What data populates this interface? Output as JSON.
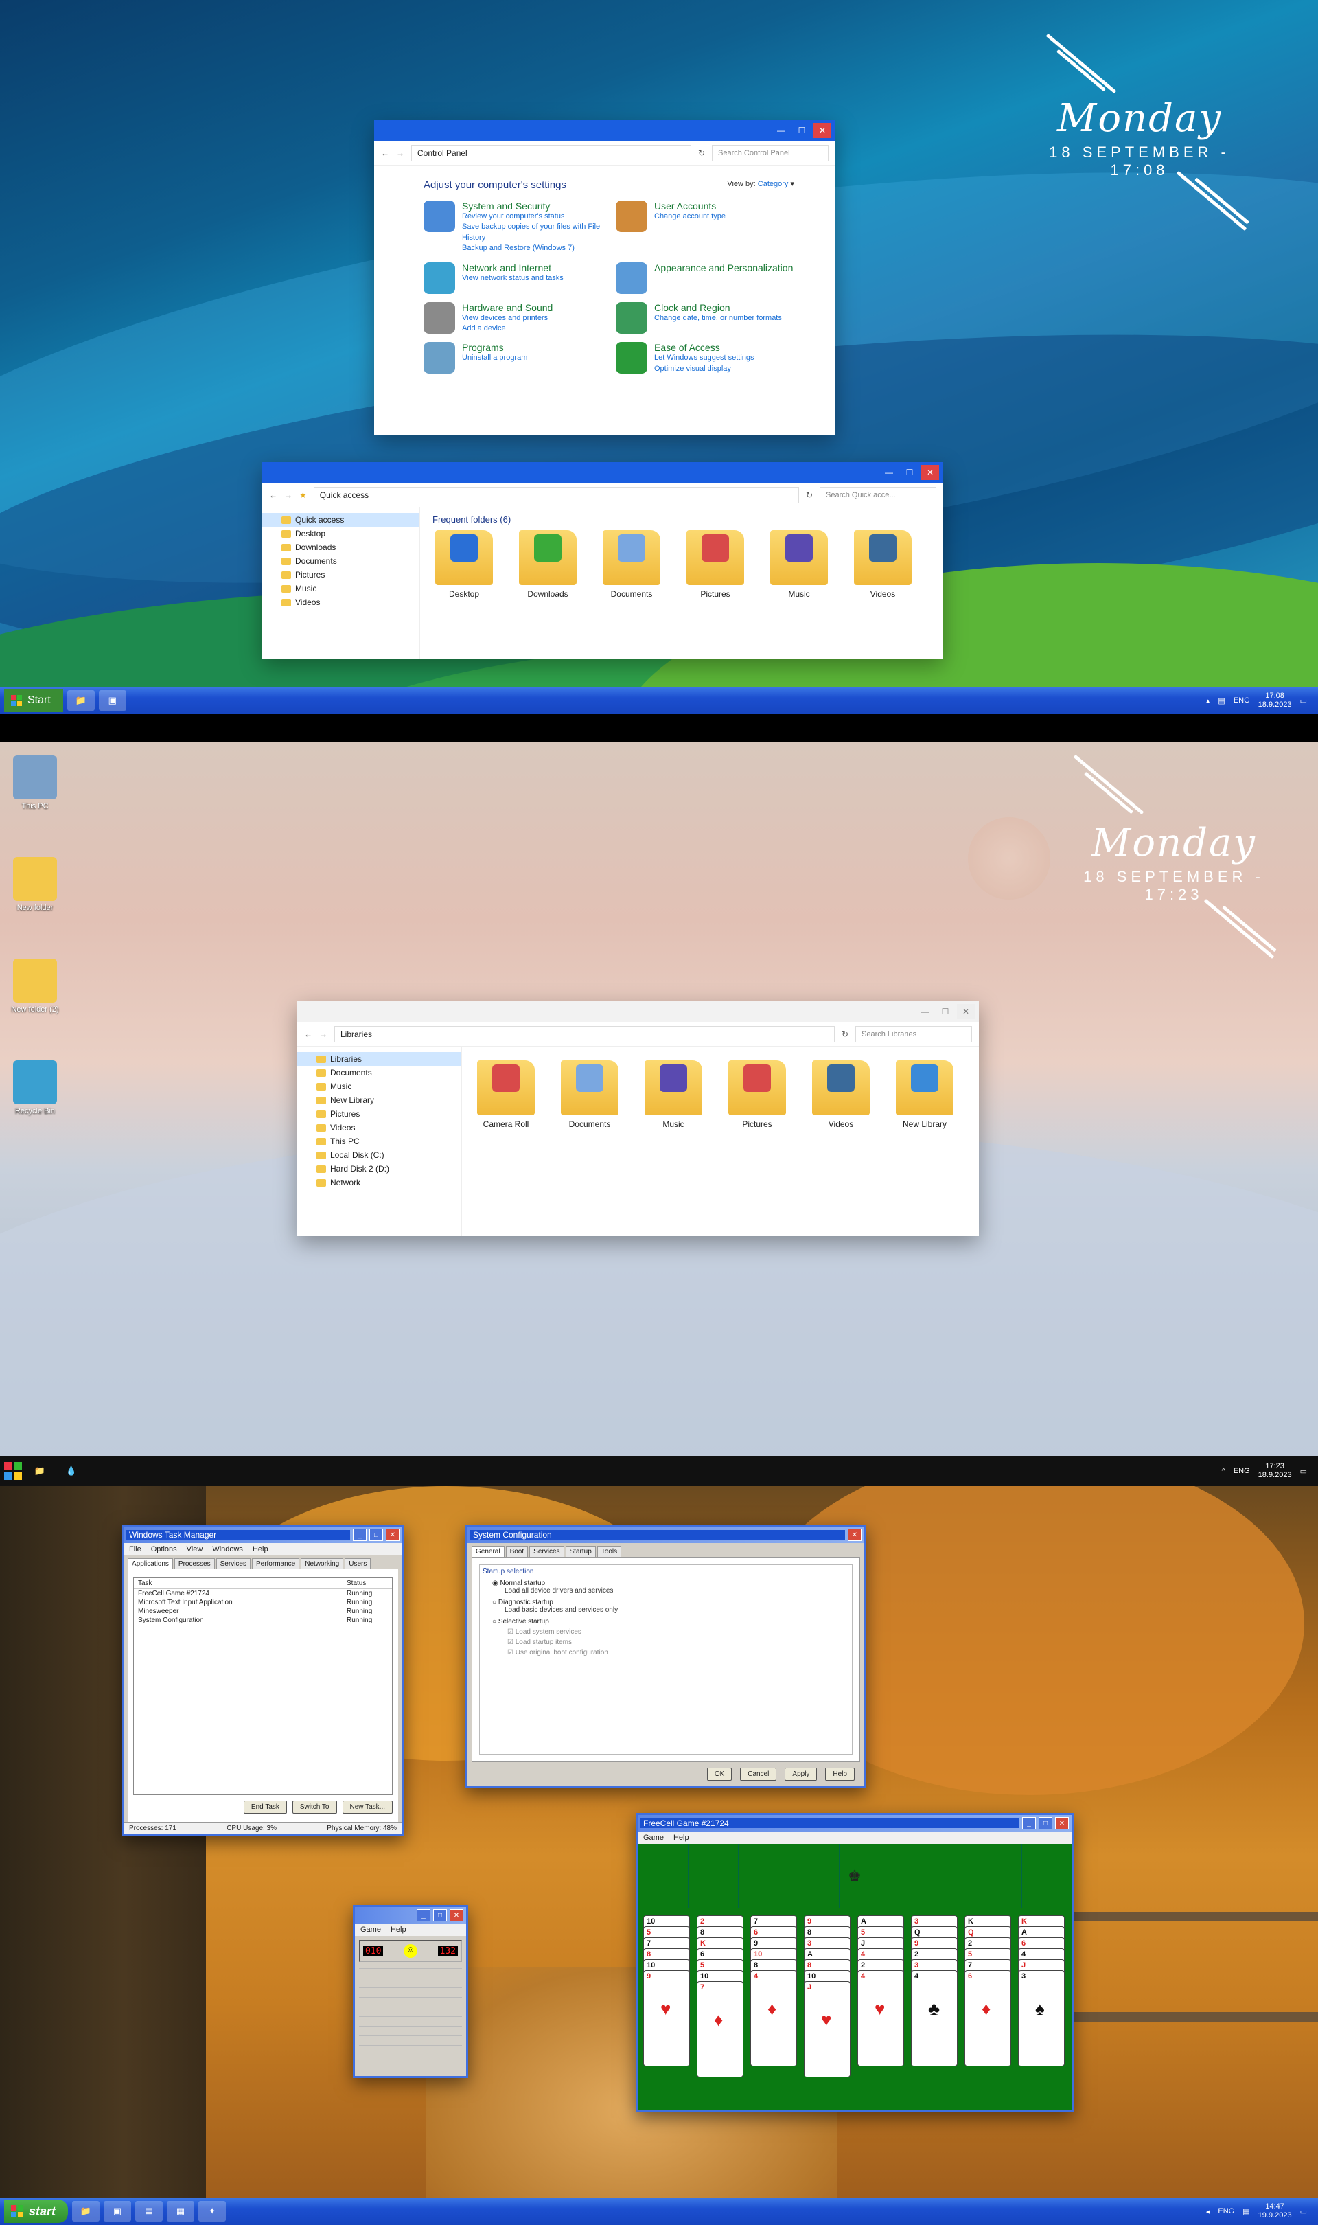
{
  "panel1": {
    "clock": {
      "day": "Monday",
      "date": "18 SEPTEMBER - 17:08"
    },
    "control_panel": {
      "address": "Control Panel",
      "search_placeholder": "Search Control Panel",
      "heading": "Adjust your computer's settings",
      "view_by_label": "View by:",
      "view_by_value": "Category",
      "left": [
        {
          "title": "System and Security",
          "links": [
            "Review your computer's status",
            "Save backup copies of your files with File History",
            "Backup and Restore (Windows 7)"
          ],
          "color": "#4a8ad8"
        },
        {
          "title": "Network and Internet",
          "links": [
            "View network status and tasks"
          ],
          "color": "#3aa2d0"
        },
        {
          "title": "Hardware and Sound",
          "links": [
            "View devices and printers",
            "Add a device"
          ],
          "color": "#8a8a8a"
        },
        {
          "title": "Programs",
          "links": [
            "Uninstall a program"
          ],
          "color": "#6aa0c8"
        }
      ],
      "right": [
        {
          "title": "User Accounts",
          "links": [
            "Change account type"
          ],
          "color": "#d08a3a"
        },
        {
          "title": "Appearance and Personalization",
          "links": [],
          "color": "#5a9ad8"
        },
        {
          "title": "Clock and Region",
          "links": [
            "Change date, time, or number formats"
          ],
          "color": "#3a9a5a"
        },
        {
          "title": "Ease of Access",
          "links": [
            "Let Windows suggest settings",
            "Optimize visual display"
          ],
          "color": "#2a9a3a"
        }
      ]
    },
    "explorer": {
      "address": "Quick access",
      "search_placeholder": "Search Quick acce...",
      "nav": [
        "Quick access",
        "Desktop",
        "Downloads",
        "Documents",
        "Pictures",
        "Music",
        "Videos"
      ],
      "header": "Frequent folders (6)",
      "folders": [
        {
          "label": "Desktop",
          "color": "#2a6fd6"
        },
        {
          "label": "Downloads",
          "color": "#3aaa3a"
        },
        {
          "label": "Documents",
          "color": "#7aa7e0"
        },
        {
          "label": "Pictures",
          "color": "#d84a4a"
        },
        {
          "label": "Music",
          "color": "#5a4ab0"
        },
        {
          "label": "Videos",
          "color": "#3a6a9a"
        }
      ]
    },
    "taskbar": {
      "start": "Start",
      "lang": "ENG",
      "time": "17:08",
      "date": "18.9.2023"
    }
  },
  "panel2": {
    "clock": {
      "day": "Monday",
      "date": "18 SEPTEMBER - 17:23"
    },
    "desktop_icons": [
      "This PC",
      "New folder",
      "New folder (2)",
      "Recycle Bin"
    ],
    "explorer": {
      "address": "Libraries",
      "search_placeholder": "Search Libraries",
      "nav": [
        "Libraries",
        "Documents",
        "Music",
        "New Library",
        "Pictures",
        "Videos",
        "This PC",
        "Local Disk (C:)",
        "Hard Disk 2 (D:)",
        "Network"
      ],
      "folders": [
        {
          "label": "Camera Roll",
          "color": "#d84a4a"
        },
        {
          "label": "Documents",
          "color": "#7aa7e0"
        },
        {
          "label": "Music",
          "color": "#5a4ab0"
        },
        {
          "label": "Pictures",
          "color": "#d84a4a"
        },
        {
          "label": "Videos",
          "color": "#3a6a9a"
        },
        {
          "label": "New Library",
          "color": "#3a8ad8"
        }
      ]
    },
    "taskbar": {
      "lang": "ENG",
      "time": "17:23",
      "date": "18.9.2023"
    }
  },
  "panel3": {
    "task_manager": {
      "title": "Windows Task Manager",
      "menu": [
        "File",
        "Options",
        "View",
        "Windows",
        "Help"
      ],
      "tabs": [
        "Applications",
        "Processes",
        "Services",
        "Performance",
        "Networking",
        "Users"
      ],
      "columns": [
        "Task",
        "Status"
      ],
      "rows": [
        {
          "task": "FreeCell Game #21724",
          "status": "Running"
        },
        {
          "task": "Microsoft Text Input Application",
          "status": "Running"
        },
        {
          "task": "Minesweeper",
          "status": "Running"
        },
        {
          "task": "System Configuration",
          "status": "Running"
        }
      ],
      "buttons": [
        "End Task",
        "Switch To",
        "New Task..."
      ],
      "status": {
        "processes": "Processes: 171",
        "cpu": "CPU Usage: 3%",
        "memory": "Physical Memory: 48%"
      }
    },
    "sysconfig": {
      "title": "System Configuration",
      "tabs": [
        "General",
        "Boot",
        "Services",
        "Startup",
        "Tools"
      ],
      "group": "Startup selection",
      "options": [
        {
          "label": "Normal startup",
          "sub": "Load all device drivers and services"
        },
        {
          "label": "Diagnostic startup",
          "sub": "Load basic devices and services only"
        },
        {
          "label": "Selective startup",
          "sub": ""
        }
      ],
      "checks": [
        "Load system services",
        "Load startup items",
        "Use original boot configuration"
      ],
      "buttons": [
        "OK",
        "Cancel",
        "Apply",
        "Help"
      ]
    },
    "minesweeper": {
      "menu": [
        "Game",
        "Help"
      ],
      "mines": "010",
      "time": "132"
    },
    "freecell": {
      "title": "FreeCell Game #21724",
      "menu": [
        "Game",
        "Help"
      ],
      "columns": [
        [
          "10",
          "5",
          "7",
          "8",
          "10",
          "9"
        ],
        [
          "2",
          "8",
          "K",
          "6",
          "5",
          "10",
          "7"
        ],
        [
          "7",
          "6",
          "9",
          "10",
          "8",
          "4"
        ],
        [
          "9",
          "8",
          "3",
          "A",
          "8",
          "10",
          "J"
        ],
        [
          "A",
          "5",
          "J",
          "4",
          "2",
          "4"
        ],
        [
          "3",
          "Q",
          "9",
          "2",
          "3",
          "4"
        ],
        [
          "K",
          "Q",
          "2",
          "5",
          "7",
          "6"
        ],
        [
          "K",
          "A",
          "6",
          "4",
          "J",
          "3"
        ]
      ]
    },
    "taskbar": {
      "start": "start",
      "lang": "ENG",
      "time": "14:47",
      "date": "19.9.2023"
    }
  }
}
